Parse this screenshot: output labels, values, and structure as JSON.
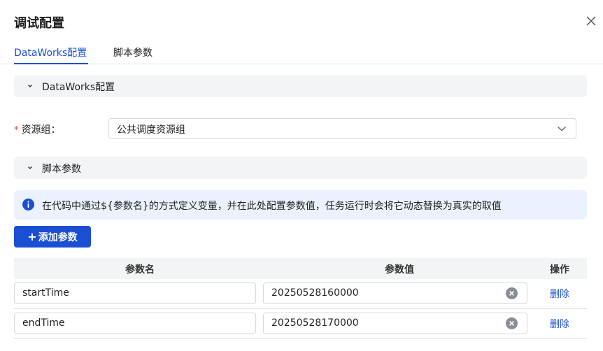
{
  "dialog": {
    "title": "调试配置",
    "close_icon": "close-icon"
  },
  "tabs": [
    {
      "label": "DataWorks配置",
      "active": true
    },
    {
      "label": "脚本参数",
      "active": false
    }
  ],
  "sections": {
    "dataworks": {
      "label": "DataWorks配置",
      "icon": "chevron-down-icon"
    },
    "script_params": {
      "label": "脚本参数",
      "icon": "chevron-down-icon"
    }
  },
  "resource_group": {
    "required_mark": "*",
    "label": "资源组：",
    "value": "公共调度资源组",
    "icon": "chevron-down-icon"
  },
  "alert": {
    "icon": "info-icon",
    "text": "在代码中通过${参数名}的方式定义变量，并在此处配置参数值，任务运行时会将它动态替换为真实的取值"
  },
  "add_button": {
    "plus": "+",
    "label": "添加参数"
  },
  "table": {
    "columns": [
      "参数名",
      "参数值",
      "操作"
    ],
    "rows": [
      {
        "name": "startTime",
        "value": "20250528160000",
        "action": "删除"
      },
      {
        "name": "endTime",
        "value": "20250528170000",
        "action": "删除"
      }
    ]
  },
  "colors": {
    "accent": "#1b4fd1",
    "section_bg": "#f3f4f6",
    "alert_bg": "#ebf2fd",
    "required": "#e43d3d"
  }
}
